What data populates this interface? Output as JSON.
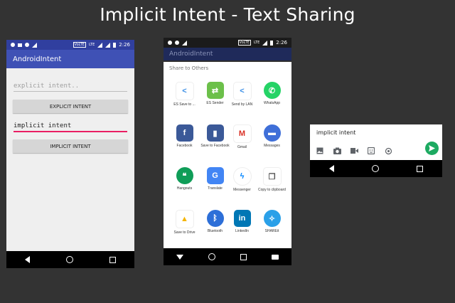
{
  "page_title": "Implicit Intent - Text Sharing",
  "status": {
    "time1": "2:26",
    "time2": "2:26",
    "lte": "LTE",
    "volte": "VoLTE"
  },
  "phone1": {
    "app_title": "AndroidIntent",
    "explicit_input_placeholder": "explicit intent..",
    "explicit_button": "EXPLICIT INTENT",
    "implicit_input_value": "implicit intent",
    "implicit_button": "IMPLICIT INTENT"
  },
  "phone2": {
    "app_title": "AndroidIntent",
    "sheet_title": "Share to Others",
    "apps": [
      {
        "label": "ES Save to ...",
        "icon": "es-save-icon",
        "color": "#ffffff"
      },
      {
        "label": "ES Sender",
        "icon": "es-sender-icon",
        "color": "#6cc04a"
      },
      {
        "label": "Send by LAN",
        "icon": "send-lan-icon",
        "color": "#ffffff"
      },
      {
        "label": "WhatsApp",
        "icon": "whatsapp-icon",
        "color": "#25d366"
      },
      {
        "label": "Facebook",
        "icon": "facebook-icon",
        "color": "#3b5998"
      },
      {
        "label": "Save to Facebook",
        "icon": "save-facebook-icon",
        "color": "#3b5998"
      },
      {
        "label": "Gmail",
        "icon": "gmail-icon",
        "color": "#ffffff"
      },
      {
        "label": "Messages",
        "icon": "messages-icon",
        "color": "#3f6fd8"
      },
      {
        "label": "Hangouts",
        "icon": "hangouts-icon",
        "color": "#0f9d58"
      },
      {
        "label": "Translate",
        "icon": "translate-icon",
        "color": "#4285f4"
      },
      {
        "label": "Messenger",
        "icon": "messenger-icon",
        "color": "#ffffff"
      },
      {
        "label": "Copy to clipboard",
        "icon": "clipboard-icon",
        "color": "#ffffff"
      },
      {
        "label": "Save to Drive",
        "icon": "drive-icon",
        "color": "#ffffff"
      },
      {
        "label": "Bluetooth",
        "icon": "bluetooth-icon",
        "color": "#2d6fd8"
      },
      {
        "label": "LinkedIn",
        "icon": "linkedin-icon",
        "color": "#0077b5"
      },
      {
        "label": "SHAREit",
        "icon": "shareit-icon",
        "color": "#2aa0e8"
      }
    ]
  },
  "phone3": {
    "message_text": "implicit intent",
    "icons": [
      "gallery-icon",
      "camera-icon",
      "video-icon",
      "sticker-icon",
      "location-icon"
    ],
    "send_icon": "send-icon"
  },
  "colors": {
    "background": "#333333",
    "primary": "#3f51b5",
    "primary_dark": "#303f9f",
    "accent": "#e91e63",
    "send": "#1daa61"
  }
}
